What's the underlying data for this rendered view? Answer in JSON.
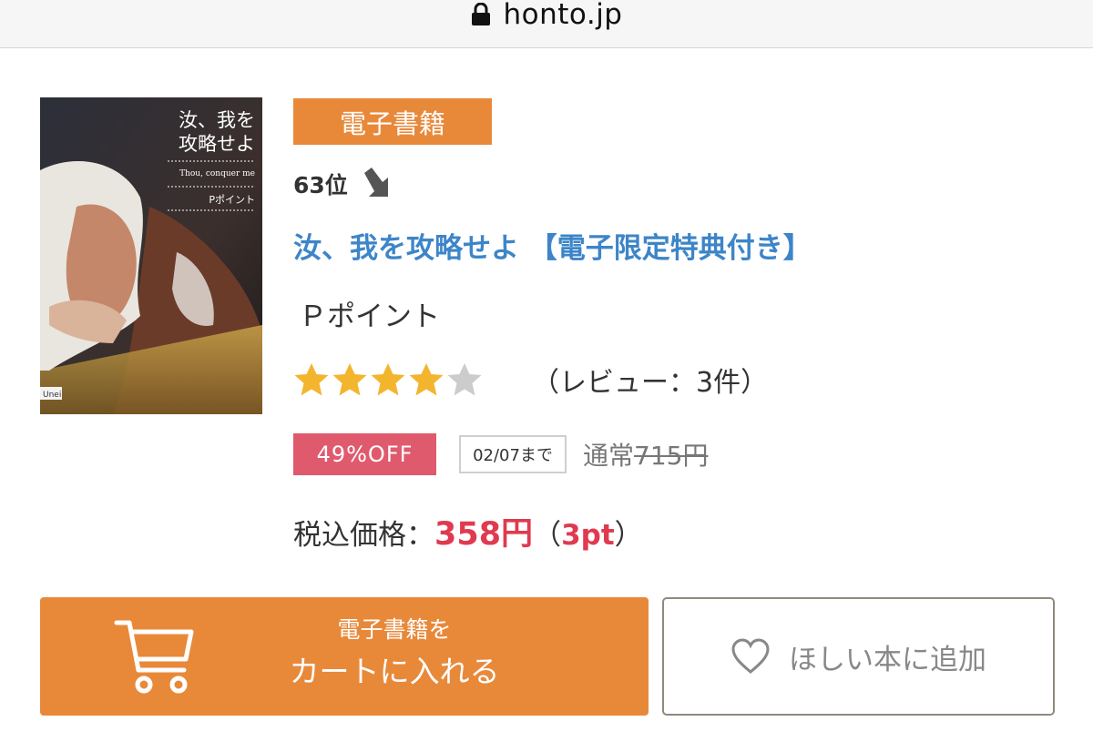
{
  "browser": {
    "url": "honto.jp",
    "lock_icon": "lock-icon"
  },
  "product": {
    "cover_icon": "book-cover-image",
    "cover_text": {
      "title_lines": [
        "汝、我を",
        "攻略せよ"
      ],
      "english": "Thou, conquer me",
      "author": "Pポイント",
      "label": "Unei"
    },
    "format_badge": "電子書籍",
    "rank": "63位",
    "rank_trend_icon": "down-arrow-icon",
    "title": "汝、我を攻略せよ 【電子限定特典付き】",
    "author": "Ｐポイント",
    "rating": {
      "value": 4,
      "max": 5,
      "reviews_text": "（レビュー：3件）",
      "star_color": "#f4b52e",
      "empty_star_color": "#cccccc"
    },
    "pricing": {
      "discount": "49%OFF",
      "deadline": "02/07まで",
      "regular_label": "通常",
      "regular_price": "715円",
      "tax_label": "税込価格：",
      "sale_price": "358円",
      "paren_open": "（",
      "points": "3pt",
      "paren_close": "）"
    }
  },
  "actions": {
    "cart_line1": "電子書籍を",
    "cart_line2": "カートに入れる",
    "cart_icon": "cart-icon",
    "wishlist_label": "ほしい本に追加",
    "wishlist_icon": "heart-icon"
  },
  "colors": {
    "accent_orange": "#e8893a",
    "title_blue": "#3d85c8",
    "price_red": "#e03a50",
    "discount_pink": "#e05a6e"
  }
}
